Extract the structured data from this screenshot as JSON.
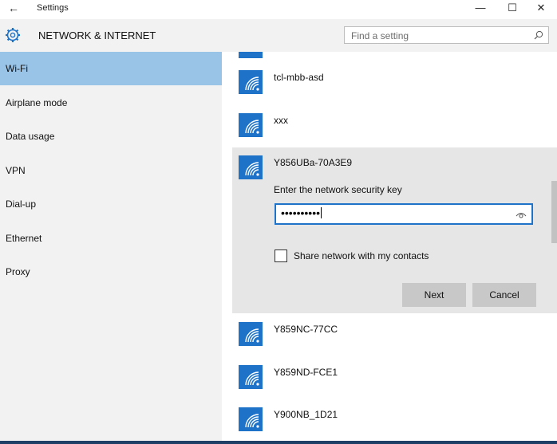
{
  "window": {
    "title": "Settings",
    "minimize_glyph": "—",
    "maximize_glyph": "☐",
    "close_glyph": "✕",
    "back_glyph": "←"
  },
  "header": {
    "title": "NETWORK & INTERNET",
    "search_placeholder": "Find a setting",
    "icon": "gear-icon"
  },
  "sidebar": {
    "items": [
      {
        "label": "Wi-Fi",
        "active": true
      },
      {
        "label": "Airplane mode"
      },
      {
        "label": "Data usage"
      },
      {
        "label": "VPN"
      },
      {
        "label": "Dial-up"
      },
      {
        "label": "Ethernet"
      },
      {
        "label": "Proxy"
      }
    ]
  },
  "networks": {
    "above": [
      "tcl-mbb-asd",
      "xxx"
    ],
    "expanded": {
      "name": "Y856UBa-70A3E9",
      "prompt": "Enter the network security key",
      "password_mask": "••••••••••",
      "share_label": "Share network with my contacts",
      "next_label": "Next",
      "cancel_label": "Cancel"
    },
    "below": [
      "Y859NC-77CC",
      "Y859ND-FCE1",
      "Y900NB_1D21"
    ]
  },
  "colors": {
    "accent": "#1e72c8",
    "active_nav": "#99c4e8",
    "sidebar_bg": "#f2f2f2",
    "expanded_bg": "#e6e6e6",
    "button_bg": "#c8c8c8"
  }
}
